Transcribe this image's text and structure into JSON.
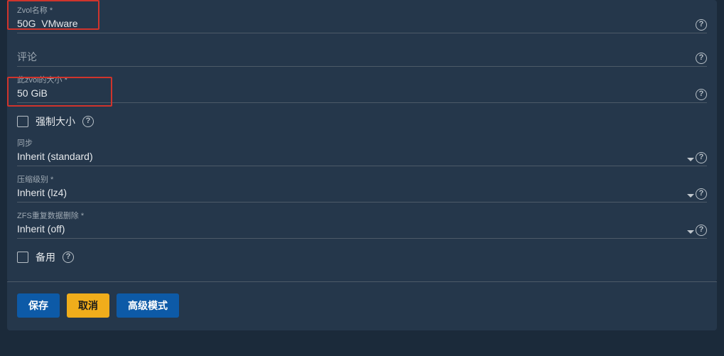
{
  "fields": {
    "zvol_name": {
      "label": "Zvol名称 *",
      "value": "50G_VMware"
    },
    "comment": {
      "label": "评论",
      "value": ""
    },
    "size": {
      "label": "此zvol的大小 *",
      "value": "50 GiB"
    },
    "force_size": {
      "label": "强制大小",
      "checked": false
    },
    "sync": {
      "label": "同步",
      "value": "Inherit (standard)"
    },
    "compression": {
      "label": "压缩级别 *",
      "value": "Inherit (lz4)"
    },
    "dedup": {
      "label": "ZFS重复数据删除 *",
      "value": "Inherit (off)"
    },
    "sparse": {
      "label": "备用",
      "checked": false
    }
  },
  "buttons": {
    "save": "保存",
    "cancel": "取消",
    "advanced": "高级模式"
  },
  "help_glyph": "?"
}
